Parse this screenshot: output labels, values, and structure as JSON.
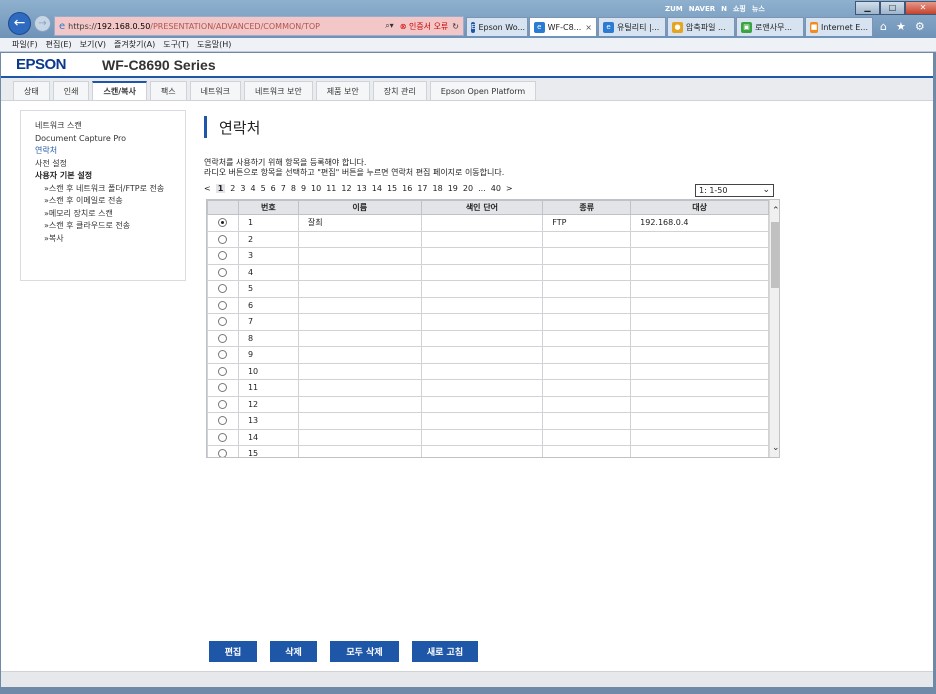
{
  "browser": {
    "address": {
      "scheme": "https://",
      "host": "192.168.0.50",
      "path": "/PRESENTATION/ADVANCED/COMMON/TOP",
      "search_icon": "magnifier-icon",
      "cert_error": "인증서 오류"
    },
    "tabs": [
      {
        "label": "Epson Wo...",
        "icon": "E",
        "color": "#1f57a8"
      },
      {
        "label": "WF-C8...",
        "icon": "e",
        "color": "#2a7bd2",
        "active": true
      },
      {
        "label": "유틸리티 |...",
        "icon": "e",
        "color": "#2a7bd2"
      },
      {
        "label": "압축파일 ...",
        "icon": "●",
        "color": "#e5a520"
      },
      {
        "label": "로앤사무...",
        "icon": "▣",
        "color": "#3aa540"
      },
      {
        "label": "Internet E...",
        "icon": "■",
        "color": "#f28b1e"
      }
    ],
    "top_links": [
      "ZUM",
      "NAVER",
      "N",
      "쇼핑",
      "뉴스"
    ],
    "menu": [
      "파일(F)",
      "편집(E)",
      "보기(V)",
      "즐겨찾기(A)",
      "도구(T)",
      "도움말(H)"
    ]
  },
  "header": {
    "brand": "EPSON",
    "model": "WF-C8690 Series"
  },
  "nav_tabs": [
    "상태",
    "인쇄",
    "스캔/복사",
    "팩스",
    "네트워크",
    "네트워크 보안",
    "제품 보안",
    "장치 관리",
    "Epson Open Platform"
  ],
  "sidebar": {
    "items": [
      {
        "label": "네트워크 스캔",
        "type": "link"
      },
      {
        "label": "Document Capture Pro",
        "type": "link"
      },
      {
        "label": "연락처",
        "type": "sel"
      },
      {
        "label": "사전 설정",
        "type": "link"
      },
      {
        "label": "사용자 기본 설정",
        "type": "head"
      },
      {
        "label": "»스캔 후 네트워크 폴더/FTP로 전송",
        "type": "sub"
      },
      {
        "label": "»스캔 후 이메일로 전송",
        "type": "sub"
      },
      {
        "label": "»메모리 장치로 스캔",
        "type": "sub"
      },
      {
        "label": "»스캔 후 클라우드로 전송",
        "type": "sub"
      },
      {
        "label": "»복사",
        "type": "sub"
      }
    ]
  },
  "main": {
    "title": "연락처",
    "desc1": "연락처를 사용하기 위해 항목을 등록해야 합니다.",
    "desc2": "라디오 버튼으로 항목을 선택하고 \"편집\" 버튼을 누르면 연락처 편집 페이지로 이동합니다.",
    "pager": {
      "prev": "<",
      "pages": [
        "1",
        "2",
        "3",
        "4",
        "5",
        "6",
        "7",
        "8",
        "9",
        "10",
        "11",
        "12",
        "13",
        "14",
        "15",
        "16",
        "17",
        "18",
        "19",
        "20"
      ],
      "ellipsis": "...",
      "last": "40",
      "next": ">"
    },
    "range": "1: 1-50",
    "columns": [
      "번호",
      "이름",
      "색인 단어",
      "종류",
      "대상"
    ],
    "rows": [
      {
        "no": "1",
        "name": "잘최",
        "index": "",
        "type": "FTP",
        "target": "192.168.0.4",
        "selected": true
      },
      {
        "no": "2"
      },
      {
        "no": "3"
      },
      {
        "no": "4"
      },
      {
        "no": "5"
      },
      {
        "no": "6"
      },
      {
        "no": "7"
      },
      {
        "no": "8"
      },
      {
        "no": "9"
      },
      {
        "no": "10"
      },
      {
        "no": "11"
      },
      {
        "no": "12"
      },
      {
        "no": "13"
      },
      {
        "no": "14"
      },
      {
        "no": "15"
      }
    ],
    "buttons": {
      "edit": "편집",
      "delete": "삭제",
      "delete_all": "모두 삭제",
      "refresh": "새로 고침"
    }
  }
}
